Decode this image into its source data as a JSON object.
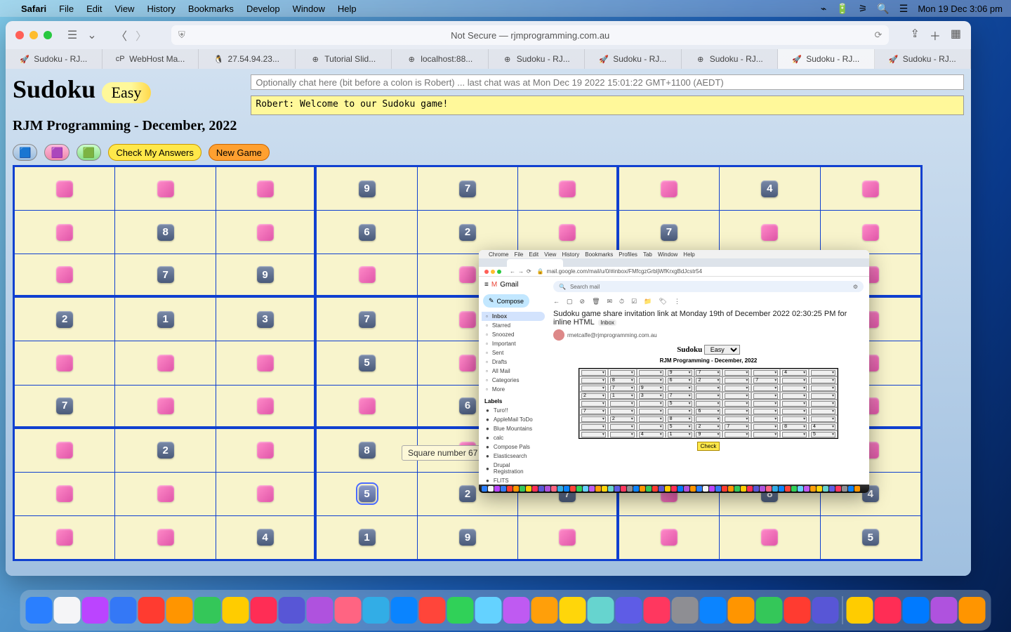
{
  "menubar": {
    "app": "Safari",
    "items": [
      "File",
      "Edit",
      "View",
      "History",
      "Bookmarks",
      "Develop",
      "Window",
      "Help"
    ],
    "clock": "Mon 19 Dec  3:06 pm"
  },
  "safari": {
    "address": "Not Secure — rjmprogramming.com.au",
    "tabs": [
      {
        "icon": "🚀",
        "label": "Sudoku - RJ..."
      },
      {
        "icon": "cP",
        "label": "WebHost Ma..."
      },
      {
        "icon": "🐧",
        "label": "27.54.94.23..."
      },
      {
        "icon": "⊕",
        "label": "Tutorial Slid..."
      },
      {
        "icon": "⊕",
        "label": "localhost:88..."
      },
      {
        "icon": "⊕",
        "label": "Sudoku - RJ..."
      },
      {
        "icon": "🚀",
        "label": "Sudoku - RJ..."
      },
      {
        "icon": "⊕",
        "label": "Sudoku - RJ..."
      },
      {
        "icon": "🚀",
        "label": "Sudoku - RJ..."
      },
      {
        "icon": "🚀",
        "label": "Sudoku - RJ..."
      }
    ],
    "active_tab": 8
  },
  "page": {
    "title": "Sudoku",
    "difficulty": "Easy",
    "subtitle": "RJM Programming - December, 2022",
    "chat_placeholder": "Optionally chat here (bit before a colon is Robert) ... last chat was at Mon Dec 19 2022 15:01:22 GMT+1100 (AEDT)",
    "chat_log": "Robert: Welcome to our Sudoku game!",
    "buttons": {
      "check": "Check My Answers",
      "new": "New Game"
    }
  },
  "sudoku": [
    [
      "",
      "",
      "",
      "9",
      "7",
      "",
      "",
      "4",
      ""
    ],
    [
      "",
      "8",
      "",
      "6",
      "2",
      "",
      "7",
      "",
      ""
    ],
    [
      "",
      "7",
      "9",
      "",
      "",
      "",
      "",
      "",
      ""
    ],
    [
      "2",
      "1",
      "3",
      "7",
      "",
      "",
      "",
      "",
      ""
    ],
    [
      "",
      "",
      "",
      "5",
      "",
      "",
      "",
      "",
      ""
    ],
    [
      "7",
      "",
      "",
      "",
      "6",
      "",
      "",
      "",
      ""
    ],
    [
      "",
      "2",
      "",
      "8",
      "",
      "",
      "",
      "",
      ""
    ],
    [
      "",
      "",
      "",
      "5",
      "2",
      "7",
      "",
      "8",
      "4"
    ],
    [
      "",
      "",
      "4",
      "1",
      "9",
      "",
      "",
      "",
      "5"
    ]
  ],
  "selected_cell": [
    7,
    3
  ],
  "tooltip": "Square number 67",
  "gmail": {
    "menubar": [
      "Chrome",
      "File",
      "Edit",
      "View",
      "History",
      "Bookmarks",
      "Profiles",
      "Tab",
      "Window",
      "Help"
    ],
    "url": "mail.google.com/mail/u/0/#inbox/FMfcgzGrbljWfKrxgBdJcstr54",
    "logo": "Gmail",
    "search_placeholder": "Search mail",
    "compose": "Compose",
    "nav": [
      "Inbox",
      "Starred",
      "Snoozed",
      "Important",
      "Sent",
      "Drafts",
      "All Mail",
      "Categories",
      "More"
    ],
    "labels_heading": "Labels",
    "labels": [
      "Turo!!",
      "AppleMail ToDo",
      "Blue Mountains",
      "calc",
      "Compose Pals",
      "Elasticsearch",
      "Drupal Registration",
      "FLITS"
    ],
    "subject": "Sudoku game share invitation link at Monday 19th of December 2022 02:30:25 PM for inline HTML",
    "inbox_chip": "Inbox",
    "from": "rmetcalfe@rjmprogramming.com.au",
    "body_title": "Sudoku",
    "body_easy": "Easy",
    "body_sub": "RJM Programming - December, 2022",
    "body_grid": [
      [
        "",
        "",
        "",
        "9",
        "7",
        "",
        "",
        "4",
        ""
      ],
      [
        "",
        "8",
        "",
        "6",
        "2",
        "",
        "7",
        "",
        ""
      ],
      [
        "",
        "7",
        "9",
        "",
        "",
        "",
        "",
        "",
        ""
      ],
      [
        "2",
        "1",
        "3",
        "7",
        "",
        "",
        "",
        "",
        ""
      ],
      [
        "",
        "",
        "",
        "5",
        "",
        "",
        "",
        "",
        ""
      ],
      [
        "7",
        "",
        "",
        "",
        "6",
        "",
        "",
        "",
        ""
      ],
      [
        "",
        "2",
        "",
        "8",
        "",
        "",
        "",
        "",
        ""
      ],
      [
        "",
        "",
        "",
        "5",
        "2",
        "7",
        "",
        "8",
        "4"
      ],
      [
        "",
        "",
        "4",
        "1",
        "9",
        "",
        "",
        "",
        "5"
      ]
    ],
    "check": "Check"
  },
  "dock_colors": [
    "#2a7fff",
    "#f5f5f7",
    "#bb44ff",
    "#3478f6",
    "#ff3b30",
    "#ff9500",
    "#34c759",
    "#ffcc00",
    "#ff2d55",
    "#5856d6",
    "#af52de",
    "#ff6482",
    "#32ade6",
    "#0a84ff",
    "#ff453a",
    "#30d158",
    "#64d2ff",
    "#bf5af2",
    "#ff9f0a",
    "#ffd60a",
    "#66d4cf",
    "#5e5ce6",
    "#ff375f",
    "#8e8e93",
    "#0b84ff",
    "#ff9500",
    "#34c759",
    "#ff3b30",
    "#5856d6",
    "#ffcc00",
    "#ff2d55",
    "#007aff",
    "#af52de",
    "#ff9500"
  ]
}
